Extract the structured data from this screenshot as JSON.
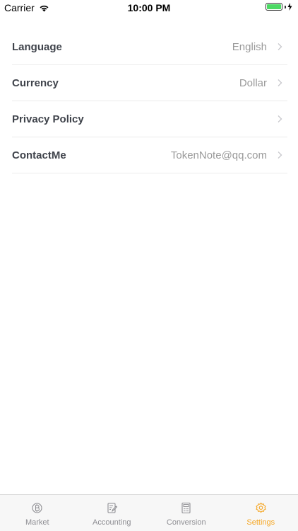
{
  "status_bar": {
    "carrier": "Carrier",
    "time": "10:00 PM"
  },
  "settings": {
    "rows": [
      {
        "label": "Language",
        "value": "English"
      },
      {
        "label": "Currency",
        "value": "Dollar"
      },
      {
        "label": "Privacy Policy",
        "value": ""
      },
      {
        "label": "ContactMe",
        "value": "TokenNote@qq.com"
      }
    ]
  },
  "tab_bar": {
    "tabs": [
      {
        "label": "Market",
        "icon": "bitcoin-icon"
      },
      {
        "label": "Accounting",
        "icon": "notes-edit-icon"
      },
      {
        "label": "Conversion",
        "icon": "calculator-icon"
      },
      {
        "label": "Settings",
        "icon": "gear-icon"
      }
    ],
    "active_tab": "Settings",
    "active_color": "#f5a623",
    "inactive_color": "#8e8e93"
  },
  "battery_color": "#4cd964"
}
